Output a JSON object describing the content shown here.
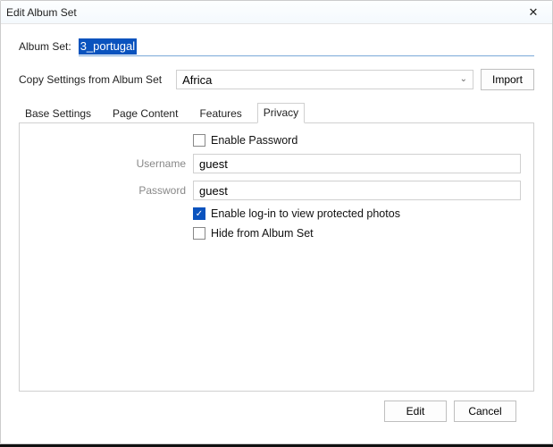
{
  "window": {
    "title": "Edit Album Set"
  },
  "albumSet": {
    "label": "Album Set:",
    "value": "3_portugal"
  },
  "copySettings": {
    "label": "Copy Settings from Album Set",
    "selected": "Africa",
    "importLabel": "Import"
  },
  "tabs": {
    "baseSettings": "Base Settings",
    "pageContent": "Page Content",
    "features": "Features",
    "privacy": "Privacy",
    "active": "privacy"
  },
  "privacyPanel": {
    "enablePassword": {
      "label": "Enable Password",
      "checked": false
    },
    "username": {
      "label": "Username",
      "value": "guest"
    },
    "password": {
      "label": "Password",
      "value": "guest"
    },
    "enableLogin": {
      "label": "Enable log-in to view protected photos",
      "checked": true
    },
    "hideFromSet": {
      "label": "Hide from Album Set",
      "checked": false
    }
  },
  "footer": {
    "edit": "Edit",
    "cancel": "Cancel"
  }
}
